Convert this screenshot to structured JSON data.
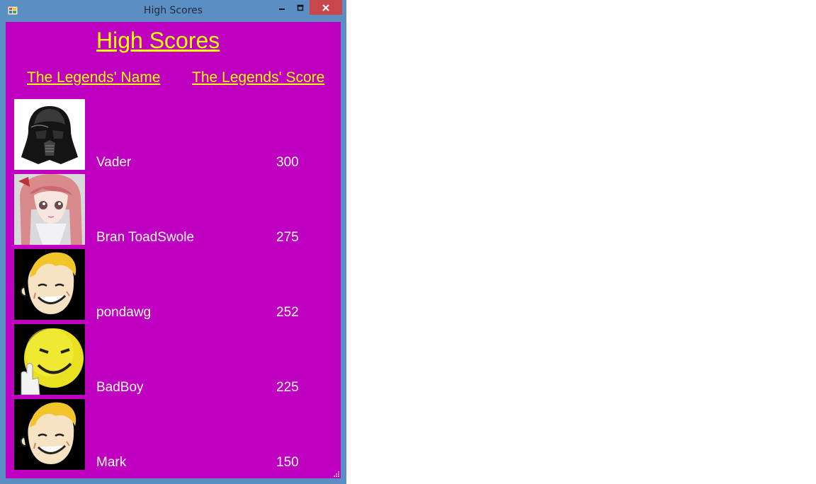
{
  "window": {
    "title": "High Scores",
    "minimize_icon": "minimize-icon",
    "maximize_icon": "maximize-icon",
    "close_icon": "close-icon"
  },
  "page": {
    "heading": "High Scores",
    "col_name_header": "The Legends' Name",
    "col_score_header": "The Legends' Score"
  },
  "scores": [
    {
      "name": "Vader",
      "score": "300",
      "avatar": "darth-vader-helmet"
    },
    {
      "name": "Bran ToadSwole",
      "score": "275",
      "avatar": "anime-girl"
    },
    {
      "name": "pondawg",
      "score": "252",
      "avatar": "vault-boy"
    },
    {
      "name": "BadBoy",
      "score": "225",
      "avatar": "smiley-face"
    },
    {
      "name": "Mark",
      "score": "150",
      "avatar": "vault-boy"
    }
  ],
  "colors": {
    "client_bg": "#c000c0",
    "heading": "#ffff00",
    "row_text": "#ffffff",
    "frame": "#5b8fc4",
    "close_btn": "#c7474a"
  }
}
